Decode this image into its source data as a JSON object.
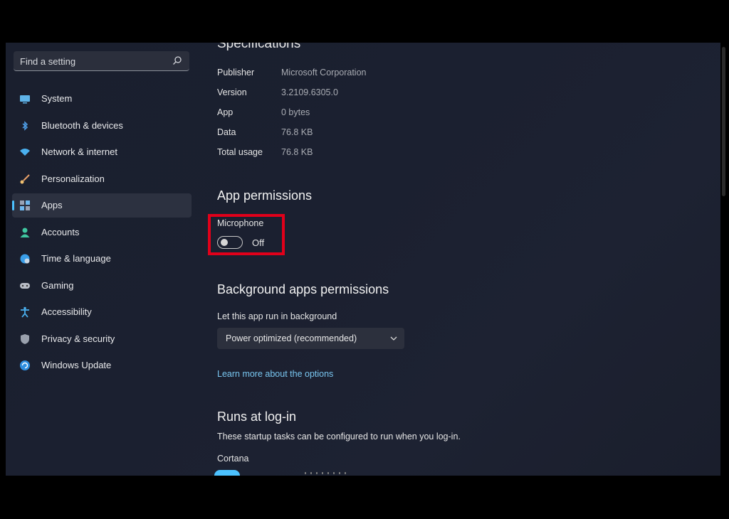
{
  "search": {
    "placeholder": "Find a setting",
    "icon": "search-icon"
  },
  "nav": [
    {
      "label": "System",
      "icon": "system-icon"
    },
    {
      "label": "Bluetooth & devices",
      "icon": "bluetooth-icon"
    },
    {
      "label": "Network & internet",
      "icon": "wifi-icon"
    },
    {
      "label": "Personalization",
      "icon": "brush-icon"
    },
    {
      "label": "Apps",
      "icon": "apps-icon",
      "selected": true
    },
    {
      "label": "Accounts",
      "icon": "person-icon"
    },
    {
      "label": "Time & language",
      "icon": "globe-clock-icon"
    },
    {
      "label": "Gaming",
      "icon": "gamepad-icon"
    },
    {
      "label": "Accessibility",
      "icon": "accessibility-icon"
    },
    {
      "label": "Privacy & security",
      "icon": "shield-icon"
    },
    {
      "label": "Windows Update",
      "icon": "update-icon"
    }
  ],
  "specs": {
    "title": "Specifications",
    "rows": [
      {
        "key": "Publisher",
        "value": "Microsoft Corporation"
      },
      {
        "key": "Version",
        "value": "3.2109.6305.0"
      },
      {
        "key": "App",
        "value": "0 bytes"
      },
      {
        "key": "Data",
        "value": "76.8 KB"
      },
      {
        "key": "Total usage",
        "value": "76.8 KB"
      }
    ]
  },
  "permissions": {
    "title": "App permissions",
    "microphone_label": "Microphone",
    "microphone_state": "Off",
    "microphone_on": false
  },
  "background": {
    "title": "Background apps permissions",
    "label": "Let this app run in background",
    "dropdown_value": "Power optimized (recommended)",
    "link": "Learn more about the options"
  },
  "startup": {
    "title": "Runs at log-in",
    "description": "These startup tasks can be configured to run when you log-in.",
    "task_label": "Cortana"
  },
  "colors": {
    "accent": "#4cc2ff",
    "highlight": "#e1001a",
    "link": "#79c6f0"
  }
}
